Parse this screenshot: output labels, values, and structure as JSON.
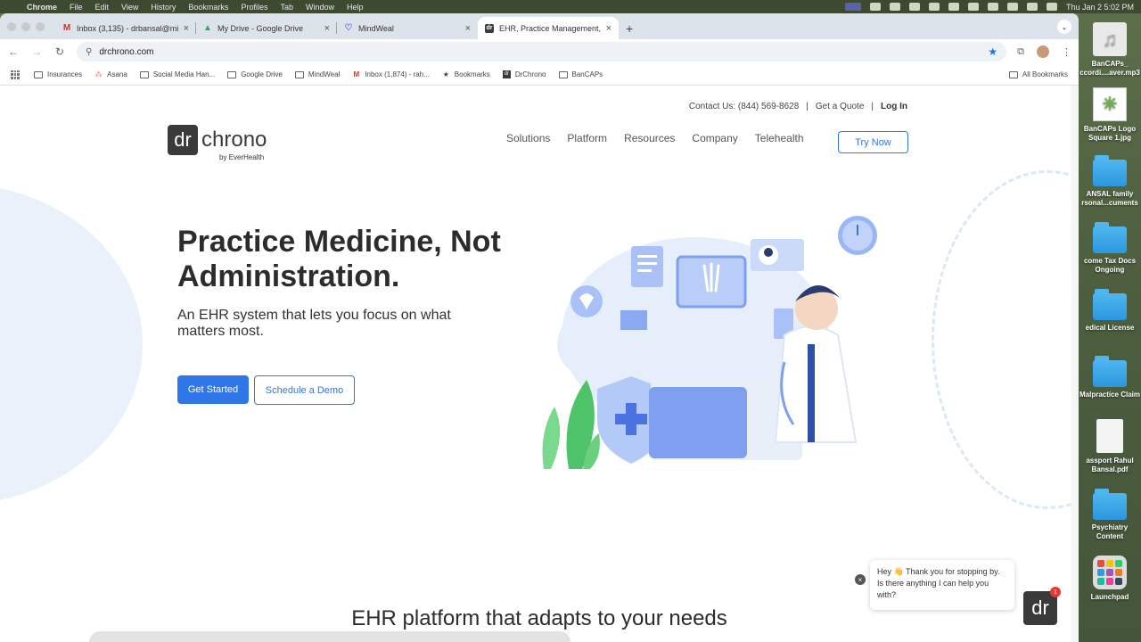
{
  "menubar": {
    "app": "Chrome",
    "items": [
      "File",
      "Edit",
      "View",
      "History",
      "Bookmarks",
      "Profiles",
      "Tab",
      "Window",
      "Help"
    ],
    "clock": "Thu Jan 2  5:02 PM"
  },
  "tabs": [
    {
      "title": "Inbox (3,135) - drbansal@mi",
      "icon": "gmail-icon",
      "active": false
    },
    {
      "title": "My Drive - Google Drive",
      "icon": "drive-icon",
      "active": false
    },
    {
      "title": "MindWeal",
      "icon": "mindweal-icon",
      "active": false
    },
    {
      "title": "EHR, Practice Management, M",
      "icon": "drchrono-icon",
      "active": true
    }
  ],
  "address": {
    "url": "drchrono.com"
  },
  "bookmarks": {
    "items": [
      {
        "label": "Insurances",
        "type": "folder"
      },
      {
        "label": "Asana",
        "type": "site"
      },
      {
        "label": "Social Media Han...",
        "type": "folder"
      },
      {
        "label": "Google Drive",
        "type": "folder"
      },
      {
        "label": "MindWeal",
        "type": "folder"
      },
      {
        "label": "Inbox (1,874) - rah...",
        "type": "site"
      },
      {
        "label": "Bookmarks",
        "type": "site"
      },
      {
        "label": "DrChrono",
        "type": "site"
      },
      {
        "label": "BanCAPs",
        "type": "folder"
      }
    ],
    "all": "All Bookmarks"
  },
  "site": {
    "contact": "Contact Us: (844) 569-8628",
    "sep1": "|",
    "quote": "Get a Quote",
    "sep2": "|",
    "login": "Log In",
    "logo_box": "dr",
    "logo_word": "chrono",
    "logo_sub": "by EverHealth",
    "nav": [
      "Solutions",
      "Platform",
      "Resources",
      "Company",
      "Telehealth"
    ],
    "try_now": "Try Now",
    "hero_title": "Practice Medicine, Not Administration.",
    "hero_sub": "An EHR system that lets you focus on what matters most.",
    "get_started": "Get Started",
    "schedule_demo": "Schedule a Demo",
    "section_title": "EHR platform that adapts to your needs"
  },
  "chat": {
    "message": "Hey 👋 Thank you for stopping by. Is there anything I can help you with?",
    "close": "×",
    "avatar": "dr",
    "badge": "1"
  },
  "desktop": [
    {
      "label": "BanCAPs_ ccordi....aver.mp3",
      "kind": "music"
    },
    {
      "label": "BanCAPs Logo Square 1.jpg",
      "kind": "image"
    },
    {
      "label": "ANSAL family rsonal...cuments",
      "kind": "folder"
    },
    {
      "label": "come Tax Docs Ongoing",
      "kind": "folder"
    },
    {
      "label": "edical License",
      "kind": "folder"
    },
    {
      "label": "Malpractice Claim",
      "kind": "folder"
    },
    {
      "label": "assport Rahul Bansal.pdf",
      "kind": "doc"
    },
    {
      "label": "Psychiatry Content",
      "kind": "folder"
    },
    {
      "label": "Launchpad",
      "kind": "app"
    }
  ]
}
